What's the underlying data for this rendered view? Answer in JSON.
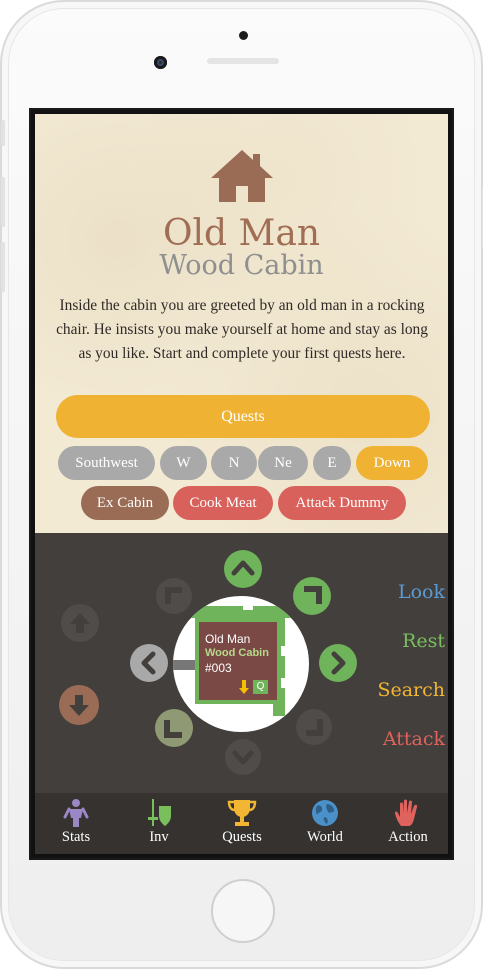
{
  "location": {
    "name": "Old Man",
    "subname": "Wood Cabin",
    "description": "Inside the cabin you are greeted by an old man in a rocking chair. He insists you make yourself at home and stay as long as you like. Start and complete your first quests here."
  },
  "quests_button": "Quests",
  "directions": [
    "Southwest",
    "W",
    "N",
    "Ne",
    "E",
    "Down"
  ],
  "interactions": [
    "Ex Cabin",
    "Cook Meat",
    "Attack Dummy"
  ],
  "minimap": {
    "name": "Old Man",
    "subname": "Wood Cabin",
    "code": "#003",
    "badge": "Q"
  },
  "actions": [
    "Look",
    "Rest",
    "Search",
    "Attack"
  ],
  "tabs": [
    {
      "label": "Stats",
      "icon": "person-icon"
    },
    {
      "label": "Inv",
      "icon": "sword-shield-icon"
    },
    {
      "label": "Quests",
      "icon": "trophy-icon"
    },
    {
      "label": "World",
      "icon": "globe-icon"
    },
    {
      "label": "Action",
      "icon": "hand-icon"
    }
  ],
  "colors": {
    "parchment": "#f3ead4",
    "accent_orange": "#efb233",
    "brown": "#9a6c56",
    "red": "#d9615b",
    "gray": "#a9a9a9",
    "green": "#6fb35b",
    "dark": "#433f3c",
    "look": "#5b9bd5",
    "rest": "#79c05d",
    "search": "#f2b632",
    "attack": "#e0625c"
  }
}
